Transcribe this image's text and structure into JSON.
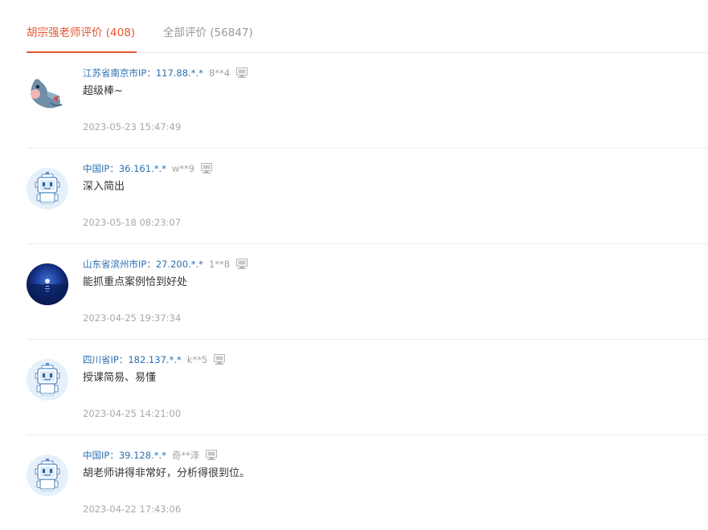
{
  "tabs": [
    {
      "label": "胡宗强老师评价 (408)",
      "active": true
    },
    {
      "label": "全部评价 (56847)",
      "active": false
    }
  ],
  "colors": {
    "accent": "#e4542d",
    "location_link": "#2a6fb0",
    "muted": "#a0a0a0"
  },
  "comments": [
    {
      "avatar": "cartoon-bird-avatar",
      "location": "江苏省南京市IP：117.88.*.*",
      "user": "8**4",
      "device": "pc-icon",
      "text": "超级棒~",
      "time": "2023-05-23 15:47:49"
    },
    {
      "avatar": "robot-avatar",
      "location": "中国IP：36.161.*.*",
      "user": "w**9",
      "device": "pc-icon",
      "text": "深入简出",
      "time": "2023-05-18 08:23:07"
    },
    {
      "avatar": "night-sea-avatar",
      "location": "山东省滨州市IP：27.200.*.*",
      "user": "1**8",
      "device": "pc-icon",
      "text": "能抓重点案例恰到好处",
      "time": "2023-04-25 19:37:34"
    },
    {
      "avatar": "robot-avatar",
      "location": "四川省IP：182.137.*.*",
      "user": "k**5",
      "device": "pc-icon",
      "text": "授课简易、易懂",
      "time": "2023-04-25 14:21:00"
    },
    {
      "avatar": "robot-avatar",
      "location": "中国IP：39.128.*.*",
      "user": "奇**泽",
      "device": "pc-icon",
      "text": "胡老师讲得非常好，分析得很到位。",
      "time": "2023-04-22 17:43:06"
    }
  ]
}
